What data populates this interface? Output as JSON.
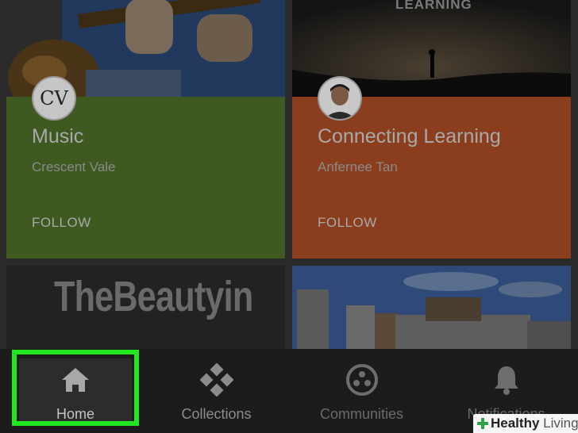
{
  "cards": [
    {
      "title": "Music",
      "author": "Crescent Vale",
      "follow": "FOLLOW",
      "avatar_text": "CV",
      "color": "#3e5a21"
    },
    {
      "title": "Connecting Learning",
      "author": "Anfernee Tan",
      "follow": "FOLLOW",
      "banner_text": "LEARNING",
      "color": "#8a3e1e"
    },
    {
      "banner_text": "TheBeautyin"
    },
    {
      "banner_text": ""
    }
  ],
  "nav": {
    "items": [
      {
        "label": "Home",
        "icon": "home-icon",
        "selected": true
      },
      {
        "label": "Collections",
        "icon": "collections-icon"
      },
      {
        "label": "Communities",
        "icon": "communities-icon"
      },
      {
        "label": "Notifications",
        "icon": "bell-icon"
      }
    ]
  },
  "highlight_color": "#22e822",
  "watermark": {
    "strong": "Healthy",
    "light": "Living"
  }
}
